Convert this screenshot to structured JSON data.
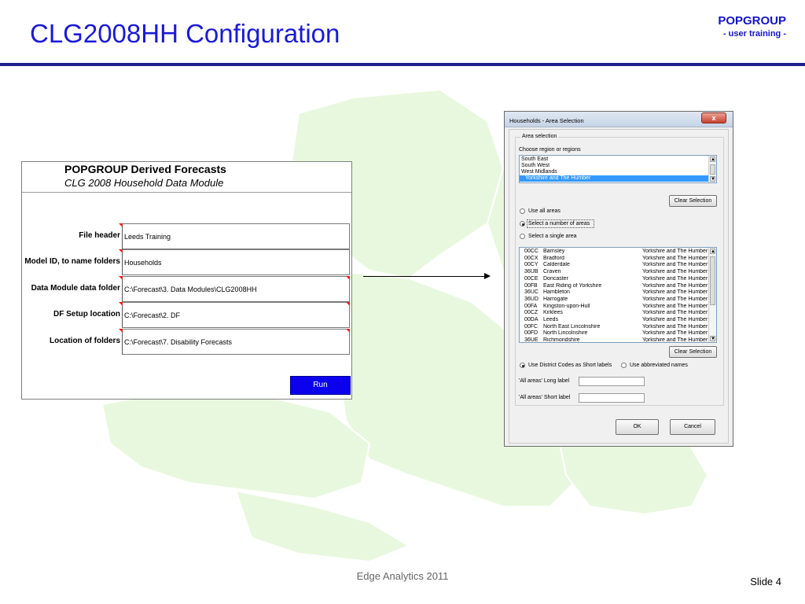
{
  "slide": {
    "title": "CLG2008HH Configuration",
    "brand": "POPGROUP",
    "brand_sub": "- user training -",
    "footer": "Edge Analytics 2011",
    "slide_number": "Slide 4"
  },
  "form": {
    "title": "POPGROUP Derived Forecasts",
    "subtitle": "CLG 2008 Household Data Module",
    "rows": [
      {
        "label": "File header",
        "value": "Leeds Training"
      },
      {
        "label": "Model ID, to name folders",
        "value": "Households"
      },
      {
        "label": "Data Module data folder",
        "value": "C:\\Forecast\\3. Data Modules\\CLG2008HH"
      },
      {
        "label": "DF Setup location",
        "value": "C:\\Forecast\\2. DF"
      },
      {
        "label": "Location of folders",
        "value": "C:\\Forecast\\7. Disability Forecasts"
      }
    ],
    "run_label": "Run"
  },
  "dialog": {
    "title": "Households - Area Selection",
    "close_glyph": "x",
    "group_label": "Area selection",
    "region_prompt": "Choose region or regions",
    "regions": [
      "South East",
      "South West",
      "West Midlands",
      "Yorkshire and The Humber"
    ],
    "selected_region": "Yorkshire and The Humber",
    "clear_label": "Clear Selection",
    "area_options": [
      "Use all areas",
      "Select a number of areas",
      "Select a single area"
    ],
    "area_selected": "Select a number of areas",
    "areas": [
      {
        "code": "00CC",
        "name": "Barnsley",
        "region": "Yorkshire and The Humber"
      },
      {
        "code": "00CX",
        "name": "Bradford",
        "region": "Yorkshire and The Humber"
      },
      {
        "code": "00CY",
        "name": "Calderdale",
        "region": "Yorkshire and The Humber"
      },
      {
        "code": "36UB",
        "name": "Craven",
        "region": "Yorkshire and The Humber"
      },
      {
        "code": "00CE",
        "name": "Doncaster",
        "region": "Yorkshire and The Humber"
      },
      {
        "code": "00FB",
        "name": "East Riding of Yorkshire",
        "region": "Yorkshire and The Humber"
      },
      {
        "code": "36UC",
        "name": "Hambleton",
        "region": "Yorkshire and The Humber"
      },
      {
        "code": "36UD",
        "name": "Harrogate",
        "region": "Yorkshire and The Humber"
      },
      {
        "code": "00FA",
        "name": "Kingston-upon-Hull",
        "region": "Yorkshire and The Humber"
      },
      {
        "code": "00CZ",
        "name": "Kirklees",
        "region": "Yorkshire and The Humber"
      },
      {
        "code": "00DA",
        "name": "Leeds",
        "region": "Yorkshire and The Humber"
      },
      {
        "code": "00FC",
        "name": "North East Lincolnshire",
        "region": "Yorkshire and The Humber"
      },
      {
        "code": "00FD",
        "name": "North Lincolnshire",
        "region": "Yorkshire and The Humber"
      },
      {
        "code": "36UE",
        "name": "Richmondshire",
        "region": "Yorkshire and The Humber"
      }
    ],
    "label_options": [
      "Use District Codes as Short labels",
      "Use abbreviated names"
    ],
    "label_selected": "Use District Codes as Short labels",
    "long_label": "'All areas' Long label",
    "short_label": "'All areas' Short label",
    "long_value": "",
    "short_value": "",
    "ok_label": "OK",
    "cancel_label": "Cancel"
  },
  "colors": {
    "title": "#1a1ad6",
    "header_rule": "#1e1e8c",
    "run_button": "#0b00ee",
    "map": "#e8f8de",
    "selection": "#3399ff"
  }
}
